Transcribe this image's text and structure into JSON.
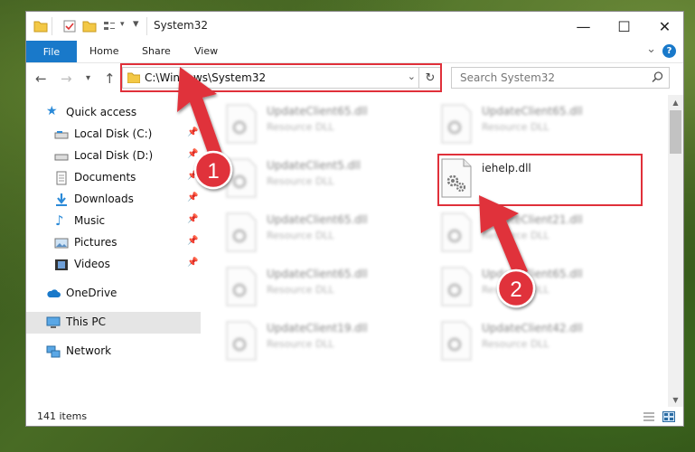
{
  "window": {
    "title": "System32",
    "controls": {
      "minimize": "—",
      "maximize": "☐",
      "close": "✕"
    }
  },
  "ribbon": {
    "file": "File",
    "tabs": [
      "Home",
      "Share",
      "View"
    ],
    "help": "?"
  },
  "address": {
    "path": "C:\\Windows\\System32",
    "search_placeholder": "Search System32"
  },
  "nav": {
    "quick_access": "Quick access",
    "items": [
      {
        "label": "Local Disk (C:)",
        "icon": "drive-icon",
        "pinned": true
      },
      {
        "label": "Local Disk (D:)",
        "icon": "drive-icon",
        "pinned": true
      },
      {
        "label": "Documents",
        "icon": "documents-icon",
        "pinned": true
      },
      {
        "label": "Downloads",
        "icon": "download-icon",
        "pinned": true
      },
      {
        "label": "Music",
        "icon": "music-icon",
        "pinned": true
      },
      {
        "label": "Pictures",
        "icon": "pictures-icon",
        "pinned": true
      },
      {
        "label": "Videos",
        "icon": "videos-icon",
        "pinned": true
      }
    ],
    "onedrive": "OneDrive",
    "this_pc": "This PC",
    "network": "Network"
  },
  "files": [
    {
      "name": "UpdateClient65.dll",
      "type": "Resource DLL",
      "blurred": true
    },
    {
      "name": "UpdateClient65.dll",
      "type": "Resource DLL",
      "blurred": true
    },
    {
      "name": "UpdateClient5.dll",
      "type": "Resource DLL",
      "blurred": true
    },
    {
      "name": "iehelp.dll",
      "type": "",
      "blurred": false
    },
    {
      "name": "UpdateClient65.dll",
      "type": "Resource DLL",
      "blurred": true
    },
    {
      "name": "UpdateClient21.dll",
      "type": "Resource DLL",
      "blurred": true
    },
    {
      "name": "UpdateClient65.dll",
      "type": "Resource DLL",
      "blurred": true
    },
    {
      "name": "UpdateClient65.dll",
      "type": "Resource DLL",
      "blurred": true
    },
    {
      "name": "UpdateClient19.dll",
      "type": "Resource DLL",
      "blurred": true
    },
    {
      "name": "UpdateClient42.dll",
      "type": "Resource DLL",
      "blurred": true
    }
  ],
  "status": {
    "count": "141 items"
  },
  "callouts": {
    "one": "1",
    "two": "2"
  },
  "colors": {
    "accent": "#1979ca",
    "highlight": "#e0303a",
    "callout": "#e0303a"
  }
}
